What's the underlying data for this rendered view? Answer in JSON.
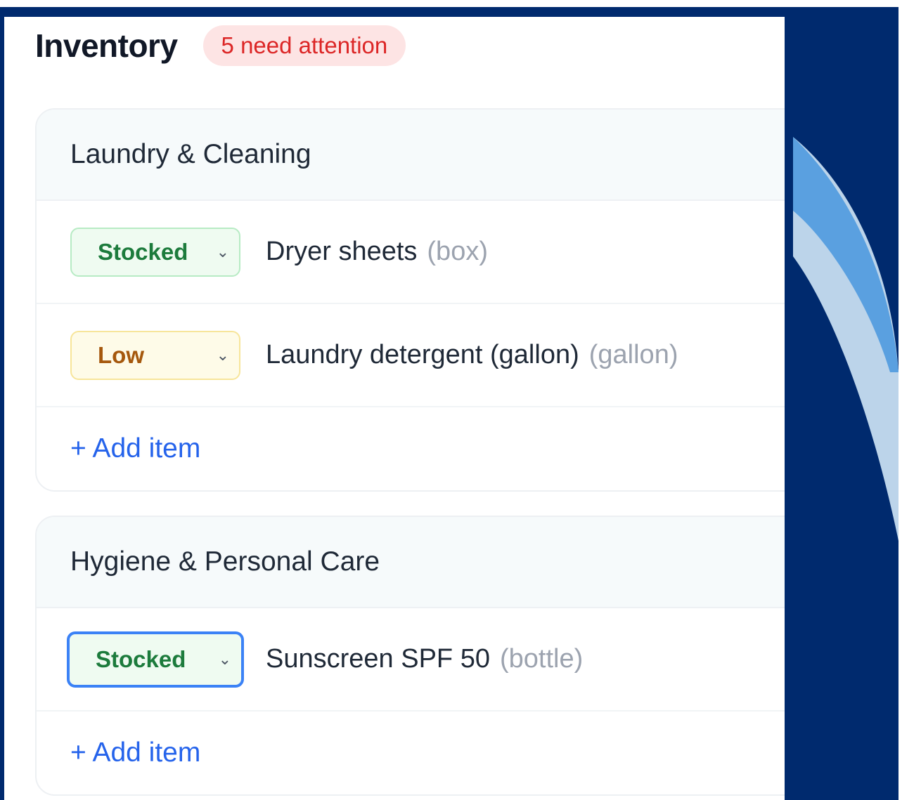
{
  "page": {
    "title": "Inventory",
    "attention_badge": "5 need attention"
  },
  "categories": [
    {
      "name": "Laundry & Cleaning",
      "items": [
        {
          "status": "Stocked",
          "name": "Dryer sheets",
          "unit": "(box)"
        },
        {
          "status": "Low",
          "name": "Laundry detergent (gallon)",
          "unit": "(gallon)"
        }
      ],
      "add_label": "+ Add item"
    },
    {
      "name": "Hygiene & Personal Care",
      "items": [
        {
          "status": "Stocked",
          "name": "Sunscreen SPF 50",
          "unit": "(bottle)"
        }
      ],
      "add_label": "+ Add item"
    }
  ],
  "icons": {
    "dropdown": "chevron-down-icon"
  },
  "colors": {
    "frame": "#002a6e",
    "stocked": "#1c7b3c",
    "low": "#a5580d",
    "attention": "#dc2626",
    "link": "#2563eb",
    "focus": "#3b82f6"
  }
}
